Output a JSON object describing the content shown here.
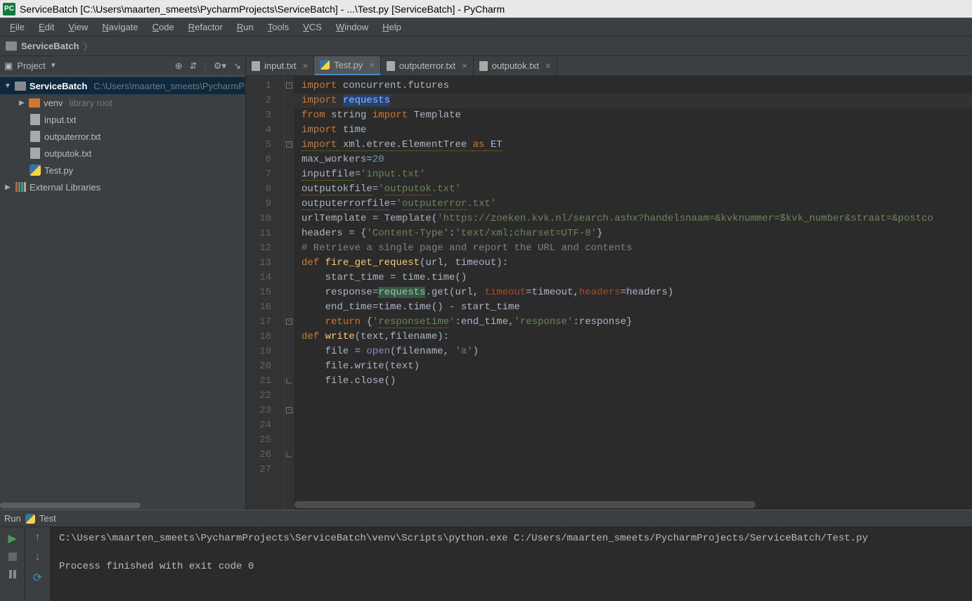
{
  "title": "ServiceBatch [C:\\Users\\maarten_smeets\\PycharmProjects\\ServiceBatch] - ...\\Test.py [ServiceBatch] - PyCharm",
  "app_icon_text": "PC",
  "menu": [
    "File",
    "Edit",
    "View",
    "Navigate",
    "Code",
    "Refactor",
    "Run",
    "Tools",
    "VCS",
    "Window",
    "Help"
  ],
  "breadcrumb": {
    "project": "ServiceBatch"
  },
  "project_tool": {
    "title": "Project",
    "root": "ServiceBatch",
    "root_path": "C:\\Users\\maarten_smeets\\PycharmProjects\\ServiceBatch",
    "venv": "venv",
    "venv_note": "library root",
    "files": [
      "input.txt",
      "outputerror.txt",
      "outputok.txt",
      "Test.py"
    ],
    "ext_libs": "External Libraries"
  },
  "tabs": [
    {
      "label": "input.txt",
      "icon": "file"
    },
    {
      "label": "Test.py",
      "icon": "py",
      "active": true
    },
    {
      "label": "outputerror.txt",
      "icon": "file"
    },
    {
      "label": "outputok.txt",
      "icon": "file"
    }
  ],
  "code": {
    "lines": [
      {
        "n": 1,
        "html": "<span class='kw'>import</span> concurrent.futures"
      },
      {
        "n": 2,
        "html": "<span class='kw'>import</span> <span class='sel'>requests</span>"
      },
      {
        "n": 3,
        "html": "<span class='kw'>from</span> string <span class='kw'>import</span> Template"
      },
      {
        "n": 4,
        "html": "<span class='kw'>import</span> time"
      },
      {
        "n": 5,
        "html": "<span class='kw warn'>import</span><span class='warn'> xml.etree.ElementTree </span><span class='kw warn'>as</span><span class='warn'> ET</span>"
      },
      {
        "n": 6,
        "html": ""
      },
      {
        "n": 7,
        "html": "max_workers=<span class='num'>20</span>"
      },
      {
        "n": 8,
        "html": "<span class='warn'>inputfile</span>=<span class='str'>'input.txt'</span>"
      },
      {
        "n": 9,
        "html": "<span class='warn'>outputokfile</span>=<span class='str'>'<span class='warn'>outputok</span>.txt'</span>"
      },
      {
        "n": 10,
        "html": "<span class='warn'>outputerrorfile</span>=<span class='str'>'<span class='warn'>outputerror</span>.txt'</span>"
      },
      {
        "n": 11,
        "html": ""
      },
      {
        "n": 12,
        "html": "urlTemplate = Template(<span class='str'>'https://zoeken.kvk.nl/search.ashx?handelsnaam=&amp;kvknummer=$kvk_number&amp;straat=&amp;postco</span>"
      },
      {
        "n": 13,
        "html": ""
      },
      {
        "n": 14,
        "html": "headers = {<span class='str'>'Content-Type'</span>:<span class='str'>'text/xml;charset=UTF-8'</span>}"
      },
      {
        "n": 15,
        "html": ""
      },
      {
        "n": 16,
        "html": "<span class='cm'># Retrieve a single page and report the URL and contents</span>"
      },
      {
        "n": 17,
        "html": "<span class='kw'>def</span> <span style='color:#ffc66d'>fire_get_request</span>(url, timeout):"
      },
      {
        "n": 18,
        "html": "    start_time = time.time()"
      },
      {
        "n": 19,
        "html": "    response=<span class='hl'>requests</span>.get(url, <span style='color:#aa4926'>timeout</span>=timeout,<span style='color:#aa4926'>headers</span>=headers)"
      },
      {
        "n": 20,
        "html": "    end_time=time.time() - start_time"
      },
      {
        "n": 21,
        "html": "    <span class='kw'>return</span> {<span class='str'>'<span class='warn'>responsetime</span>'</span>:end_time,<span class='str'>'response'</span>:response}"
      },
      {
        "n": 22,
        "html": ""
      },
      {
        "n": 23,
        "html": "<span class='kw'>def</span> <span style='color:#ffc66d'>write</span>(text,filename):"
      },
      {
        "n": 24,
        "html": "    file = <span class='bi'>open</span>(filename, <span class='str'>'a'</span>)"
      },
      {
        "n": 25,
        "html": "    file.write(text)"
      },
      {
        "n": 26,
        "html": "    file.close()"
      },
      {
        "n": 27,
        "html": ""
      }
    ]
  },
  "run": {
    "label": "Run",
    "config": "Test",
    "cmd": "C:\\Users\\maarten_smeets\\PycharmProjects\\ServiceBatch\\venv\\Scripts\\python.exe C:/Users/maarten_smeets/PycharmProjects/ServiceBatch/Test.py",
    "status": "Process finished with exit code 0"
  }
}
